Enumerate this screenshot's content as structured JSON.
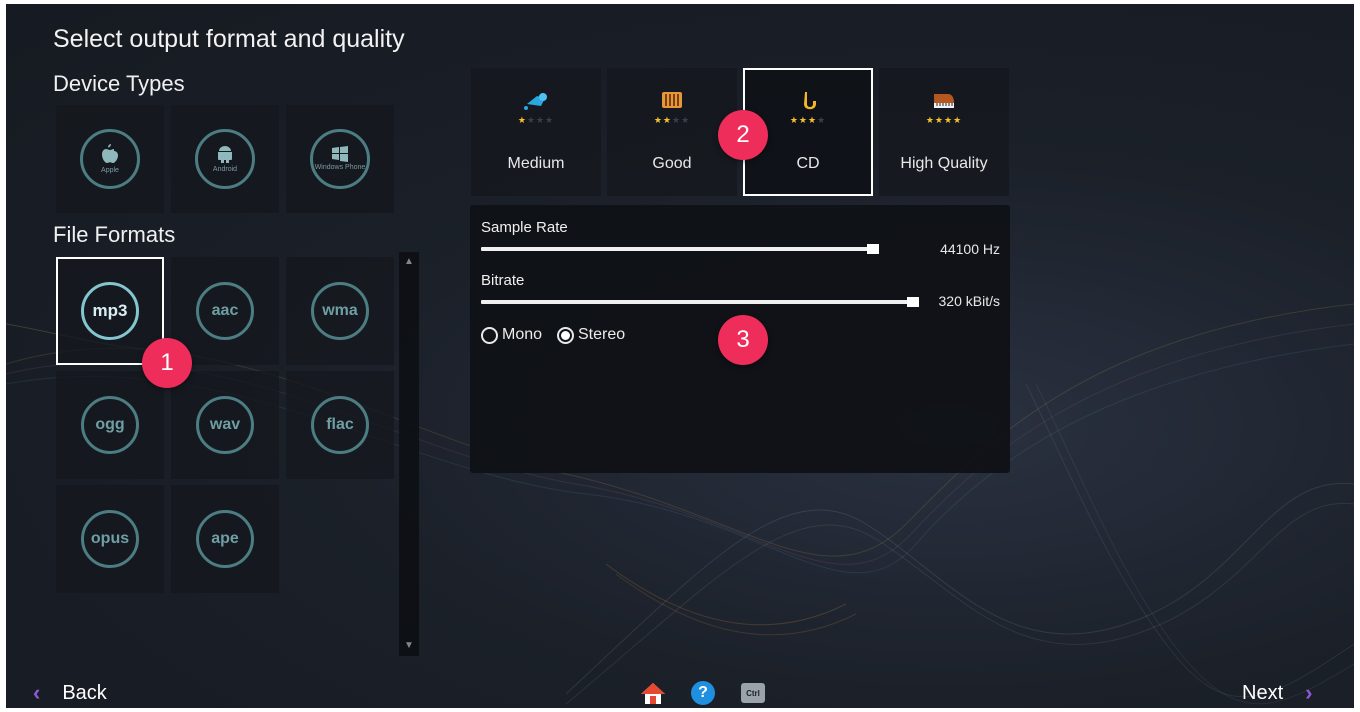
{
  "page": {
    "title": "Select output format and quality"
  },
  "device_types": {
    "heading": "Device Types",
    "items": [
      {
        "label": "Apple",
        "icon": "apple-icon"
      },
      {
        "label": "Android",
        "icon": "android-icon"
      },
      {
        "label": "Windows Phone",
        "icon": "windows-icon"
      }
    ]
  },
  "file_formats": {
    "heading": "File Formats",
    "selected": "mp3",
    "items": [
      "mp3",
      "aac",
      "wma",
      "ogg",
      "wav",
      "flac",
      "opus",
      "ape"
    ]
  },
  "quality": {
    "selected": "CD",
    "items": [
      {
        "label": "Medium",
        "stars": 1,
        "icon": "medium-quality-icon"
      },
      {
        "label": "Good",
        "stars": 2,
        "icon": "good-quality-icon"
      },
      {
        "label": "CD",
        "stars": 3,
        "icon": "saxophone-icon"
      },
      {
        "label": "High Quality",
        "stars": 4,
        "icon": "piano-icon"
      }
    ]
  },
  "settings": {
    "sample_rate": {
      "label": "Sample Rate",
      "value": "44100 Hz",
      "fraction": 0.93
    },
    "bitrate": {
      "label": "Bitrate",
      "value": "320 kBit/s",
      "fraction": 1.0
    },
    "channels": {
      "options": [
        "Mono",
        "Stereo"
      ],
      "selected": "Stereo"
    }
  },
  "badges": [
    "1",
    "2",
    "3"
  ],
  "nav": {
    "back": "Back",
    "next": "Next",
    "back_glyph": "‹",
    "next_glyph": "›"
  },
  "bottom_icons": [
    "home-icon",
    "help-icon",
    "ctrl-icon"
  ],
  "bottom_labels": {
    "help": "?",
    "ctrl": "Ctrl"
  },
  "colors": {
    "accent": "#8d5ad8",
    "badge": "#ee2d5b",
    "ring": "#4c7d83",
    "star": "#f6c12a"
  }
}
